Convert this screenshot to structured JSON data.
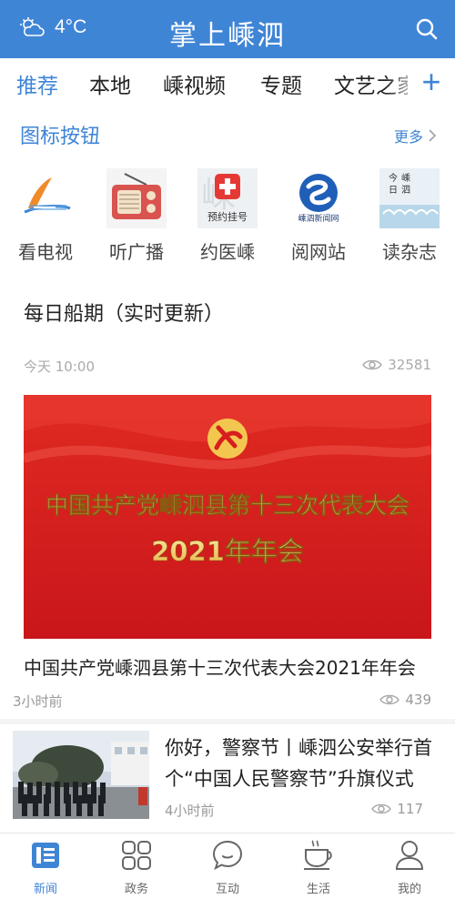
{
  "topbar": {
    "temperature": "4°C",
    "weather_icon": "partly-cloudy-icon",
    "title": "掌上嵊泗",
    "search_icon": "search-icon",
    "bg_color": "#3f85d6"
  },
  "tabs": [
    {
      "label": "推荐",
      "active": true
    },
    {
      "label": "本地"
    },
    {
      "label": "嵊视频"
    },
    {
      "label": "专题"
    },
    {
      "label": "文艺之家"
    }
  ],
  "tab_add_label": "+",
  "icon_section": {
    "title": "图标按钮",
    "more_label": "更多",
    "items": [
      {
        "label": "看电视",
        "icon": "tv-icon"
      },
      {
        "label": "听广播",
        "icon": "radio-icon"
      },
      {
        "label": "约医嵊",
        "icon": "hospital-cross-icon",
        "icon_text": "预约挂号"
      },
      {
        "label": "阅网站",
        "icon": "news-site-icon",
        "icon_text": "嵊泗新闻网"
      },
      {
        "label": "读杂志",
        "icon": "magazine-icon",
        "icon_text": "今日嵊泗"
      }
    ]
  },
  "article1": {
    "title": "每日船期（实时更新）",
    "time": "今天 10:00",
    "views": "32581"
  },
  "banner": {
    "line1": "中国共产党嵊泗县第十三次代表大会",
    "line2": "2021年年会",
    "caption": "中国共产党嵊泗县第十三次代表大会2021年年会",
    "time": "3小时前",
    "views": "439"
  },
  "news2": {
    "title": "你好，警察节丨嵊泗公安举行首个“中国人民警察节”升旗仪式",
    "time": "4小时前",
    "views": "117"
  },
  "bottom_nav": [
    {
      "label": "新闻",
      "icon": "newspaper-icon",
      "active": true
    },
    {
      "label": "政务",
      "icon": "grid-icon"
    },
    {
      "label": "互动",
      "icon": "chat-bubble-icon"
    },
    {
      "label": "生活",
      "icon": "coffee-cup-icon"
    },
    {
      "label": "我的",
      "icon": "user-icon"
    }
  ],
  "colors": {
    "accent": "#3f85d6",
    "banner_red": "#d81e1e",
    "banner_text": "#f5d77a"
  }
}
